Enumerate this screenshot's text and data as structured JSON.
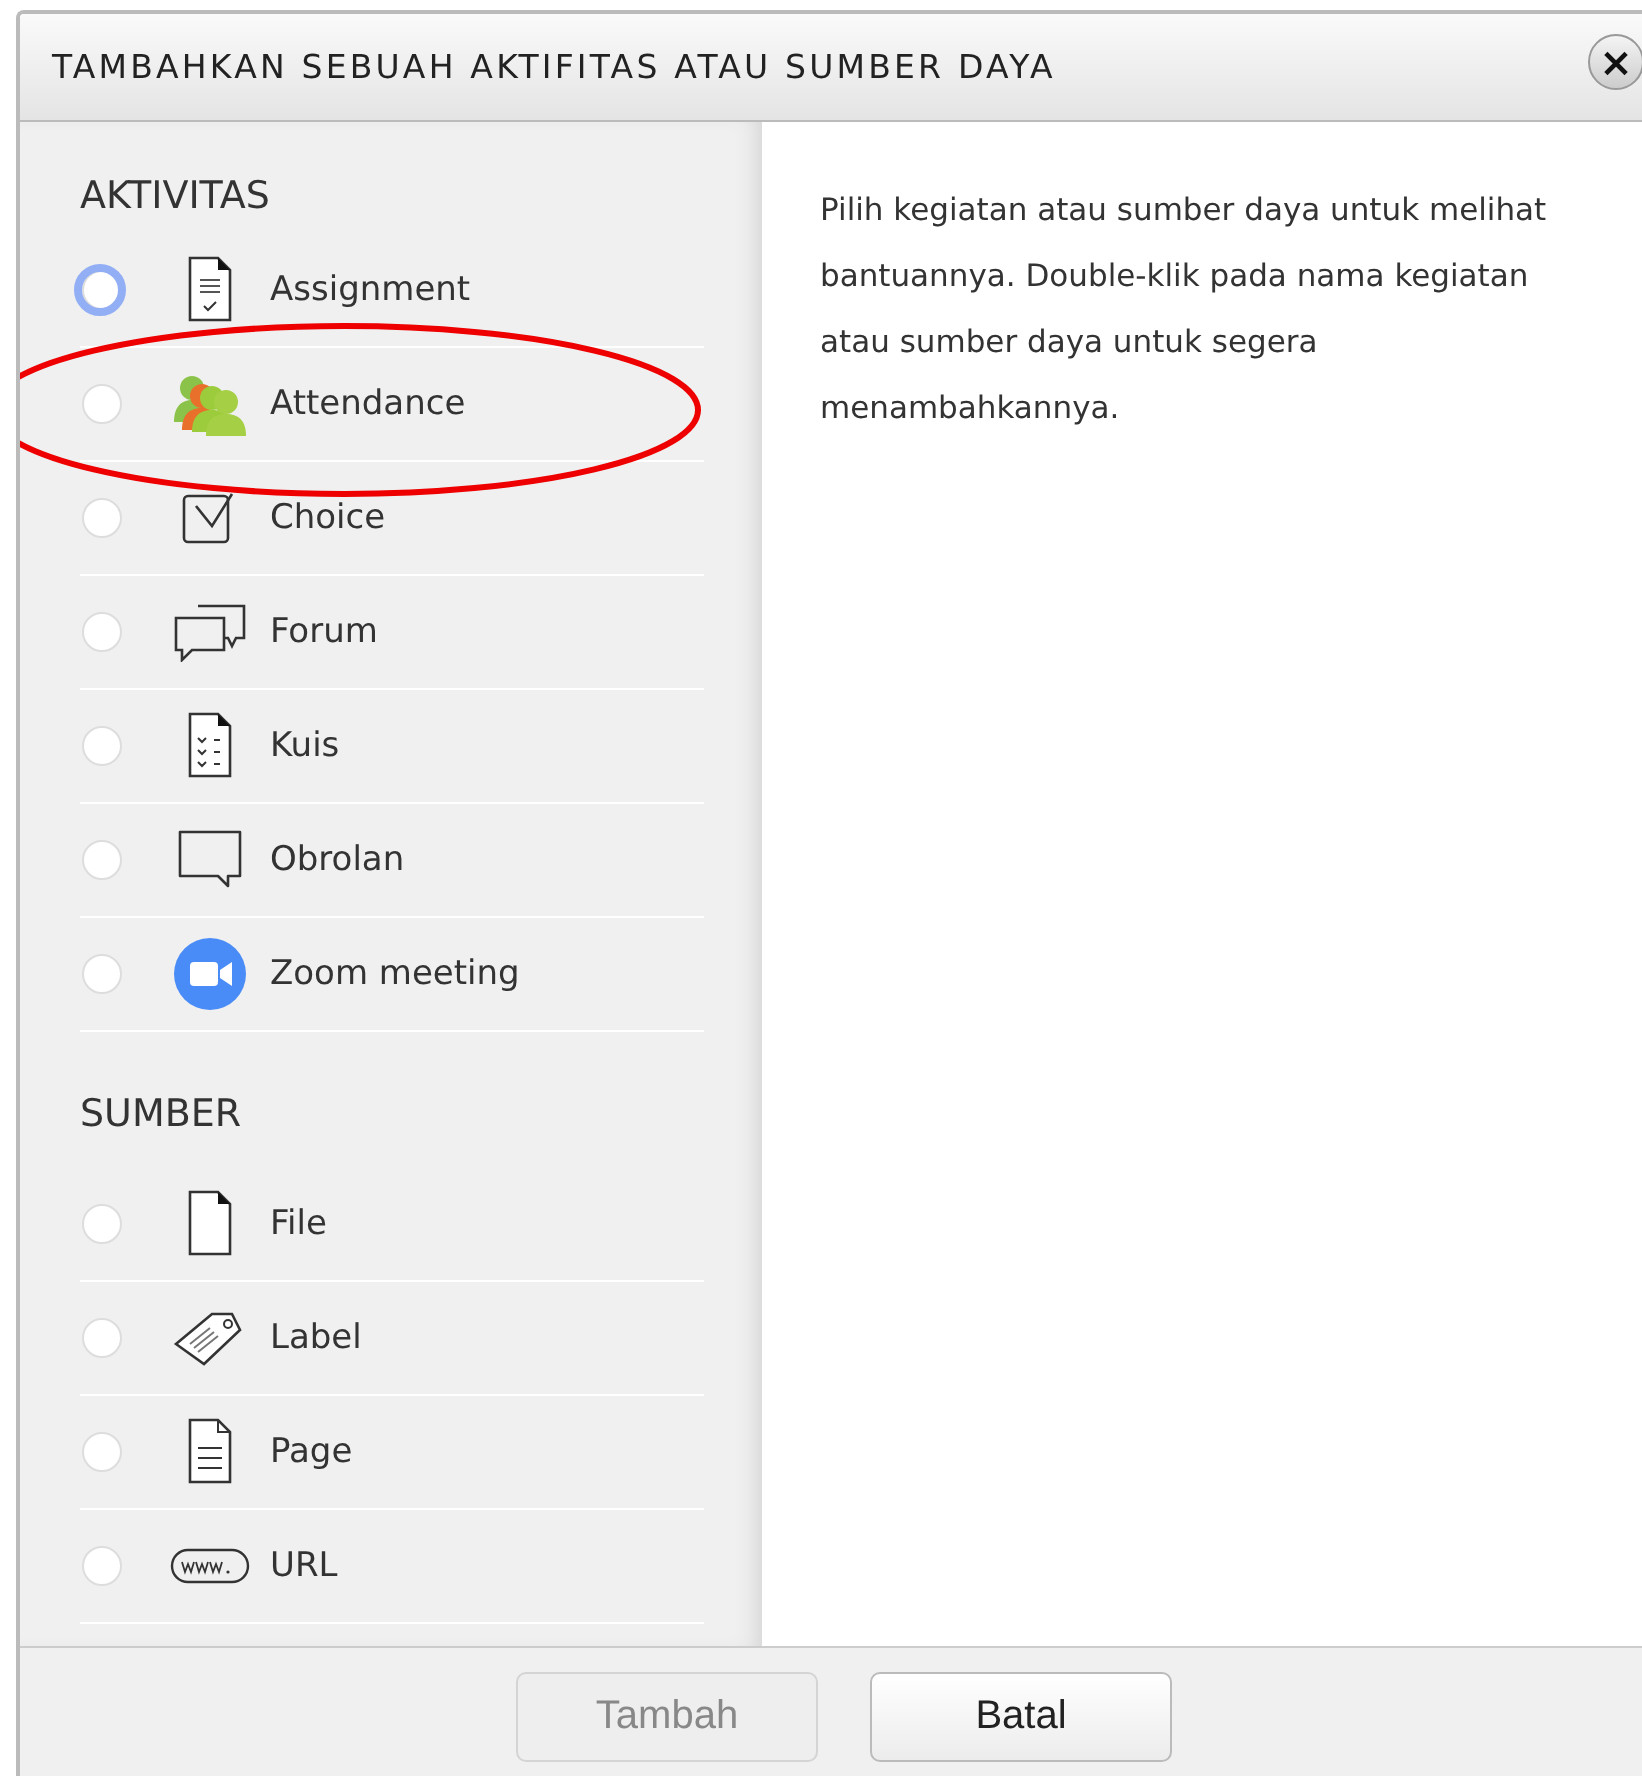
{
  "dialog": {
    "title": "TAMBAHKAN SEBUAH AKTIFITAS ATAU SUMBER DAYA",
    "close": "×"
  },
  "sections": [
    {
      "heading": "AKTIVITAS",
      "items": [
        {
          "label": "Assignment",
          "kind": "assign",
          "selected": false,
          "focused": true,
          "highlighted": false
        },
        {
          "label": "Attendance",
          "kind": "attendance",
          "selected": false,
          "focused": false,
          "highlighted": true
        },
        {
          "label": "Choice",
          "kind": "choice",
          "selected": false,
          "focused": false,
          "highlighted": false
        },
        {
          "label": "Forum",
          "kind": "forum",
          "selected": false,
          "focused": false,
          "highlighted": false
        },
        {
          "label": "Kuis",
          "kind": "quiz",
          "selected": false,
          "focused": false,
          "highlighted": false
        },
        {
          "label": "Obrolan",
          "kind": "chat",
          "selected": false,
          "focused": false,
          "highlighted": false
        },
        {
          "label": "Zoom meeting",
          "kind": "zoom",
          "selected": false,
          "focused": false,
          "highlighted": false
        }
      ]
    },
    {
      "heading": "SUMBER",
      "items": [
        {
          "label": "File",
          "kind": "file",
          "selected": false,
          "focused": false,
          "highlighted": false
        },
        {
          "label": "Label",
          "kind": "label",
          "selected": false,
          "focused": false,
          "highlighted": false
        },
        {
          "label": "Page",
          "kind": "page",
          "selected": false,
          "focused": false,
          "highlighted": false
        },
        {
          "label": "URL",
          "kind": "url",
          "selected": false,
          "focused": false,
          "highlighted": false
        }
      ]
    }
  ],
  "help": "Pilih kegiatan atau sumber daya untuk melihat bantuannya. Double-klik pada nama kegiatan atau sumber daya untuk segera menambahkannya.",
  "buttons": [
    {
      "label": "Tambah",
      "disabled": true
    },
    {
      "label": "Batal",
      "disabled": false
    }
  ]
}
